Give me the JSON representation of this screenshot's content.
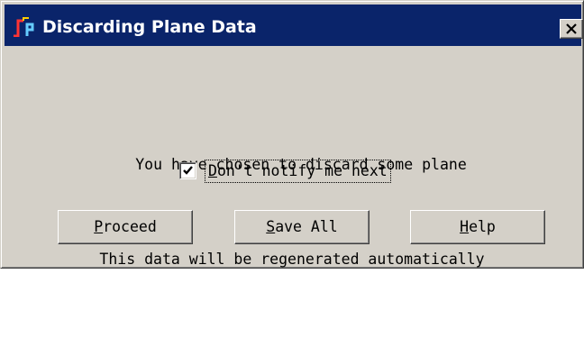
{
  "window": {
    "title": "Discarding Plane Data",
    "close_icon": "close-x-icon",
    "app_icon": "plane-app-icon",
    "title_bar_color": "#0a246a",
    "background_color": "#d4d0c8"
  },
  "message": {
    "line1": "You have chosen to discard some plane",
    "line2": "This data will be regenerated automatically"
  },
  "notify_checkbox": {
    "checked": true,
    "label_mnemonic": "D",
    "label_rest": "on't notify me next"
  },
  "buttons": {
    "proceed": {
      "mnemonic": "P",
      "rest": "roceed"
    },
    "save_all": {
      "mnemonic": "S",
      "rest": "ave All"
    },
    "help": {
      "mnemonic": "H",
      "rest": "elp"
    }
  }
}
